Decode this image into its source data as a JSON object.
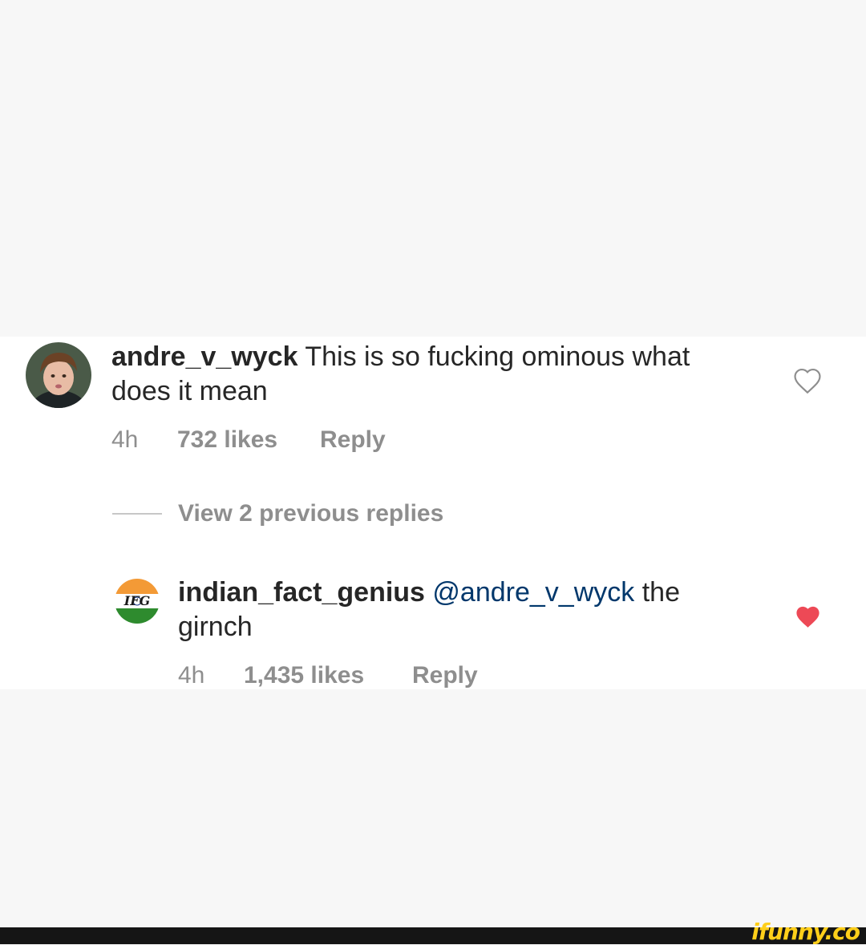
{
  "comments": [
    {
      "avatar": "user-avatar-photo",
      "username": "andre_v_wyck",
      "text": " This is so fucking ominous what does it mean",
      "time": "4h",
      "likes": "732 likes",
      "reply": "Reply",
      "liked": false
    },
    {
      "avatar": "ifg-india-logo",
      "avatar_text": "IFG",
      "username": "indian_fact_genius",
      "mention": "@andre_v_wyck",
      "text": " the girnch",
      "time": "4h",
      "likes": "1,435 likes",
      "reply": "Reply",
      "liked": true
    }
  ],
  "view_replies": "View 2 previous replies",
  "watermark": "ifunny.co",
  "colors": {
    "text": "#262626",
    "meta": "#8e8e8e",
    "mention": "#00376b",
    "heart_liked": "#ed4956",
    "heart_outline": "#8e8e8e",
    "page_bg": "#f7f7f7",
    "band_bg": "#ffffff",
    "watermark": "#ffcf1a"
  }
}
